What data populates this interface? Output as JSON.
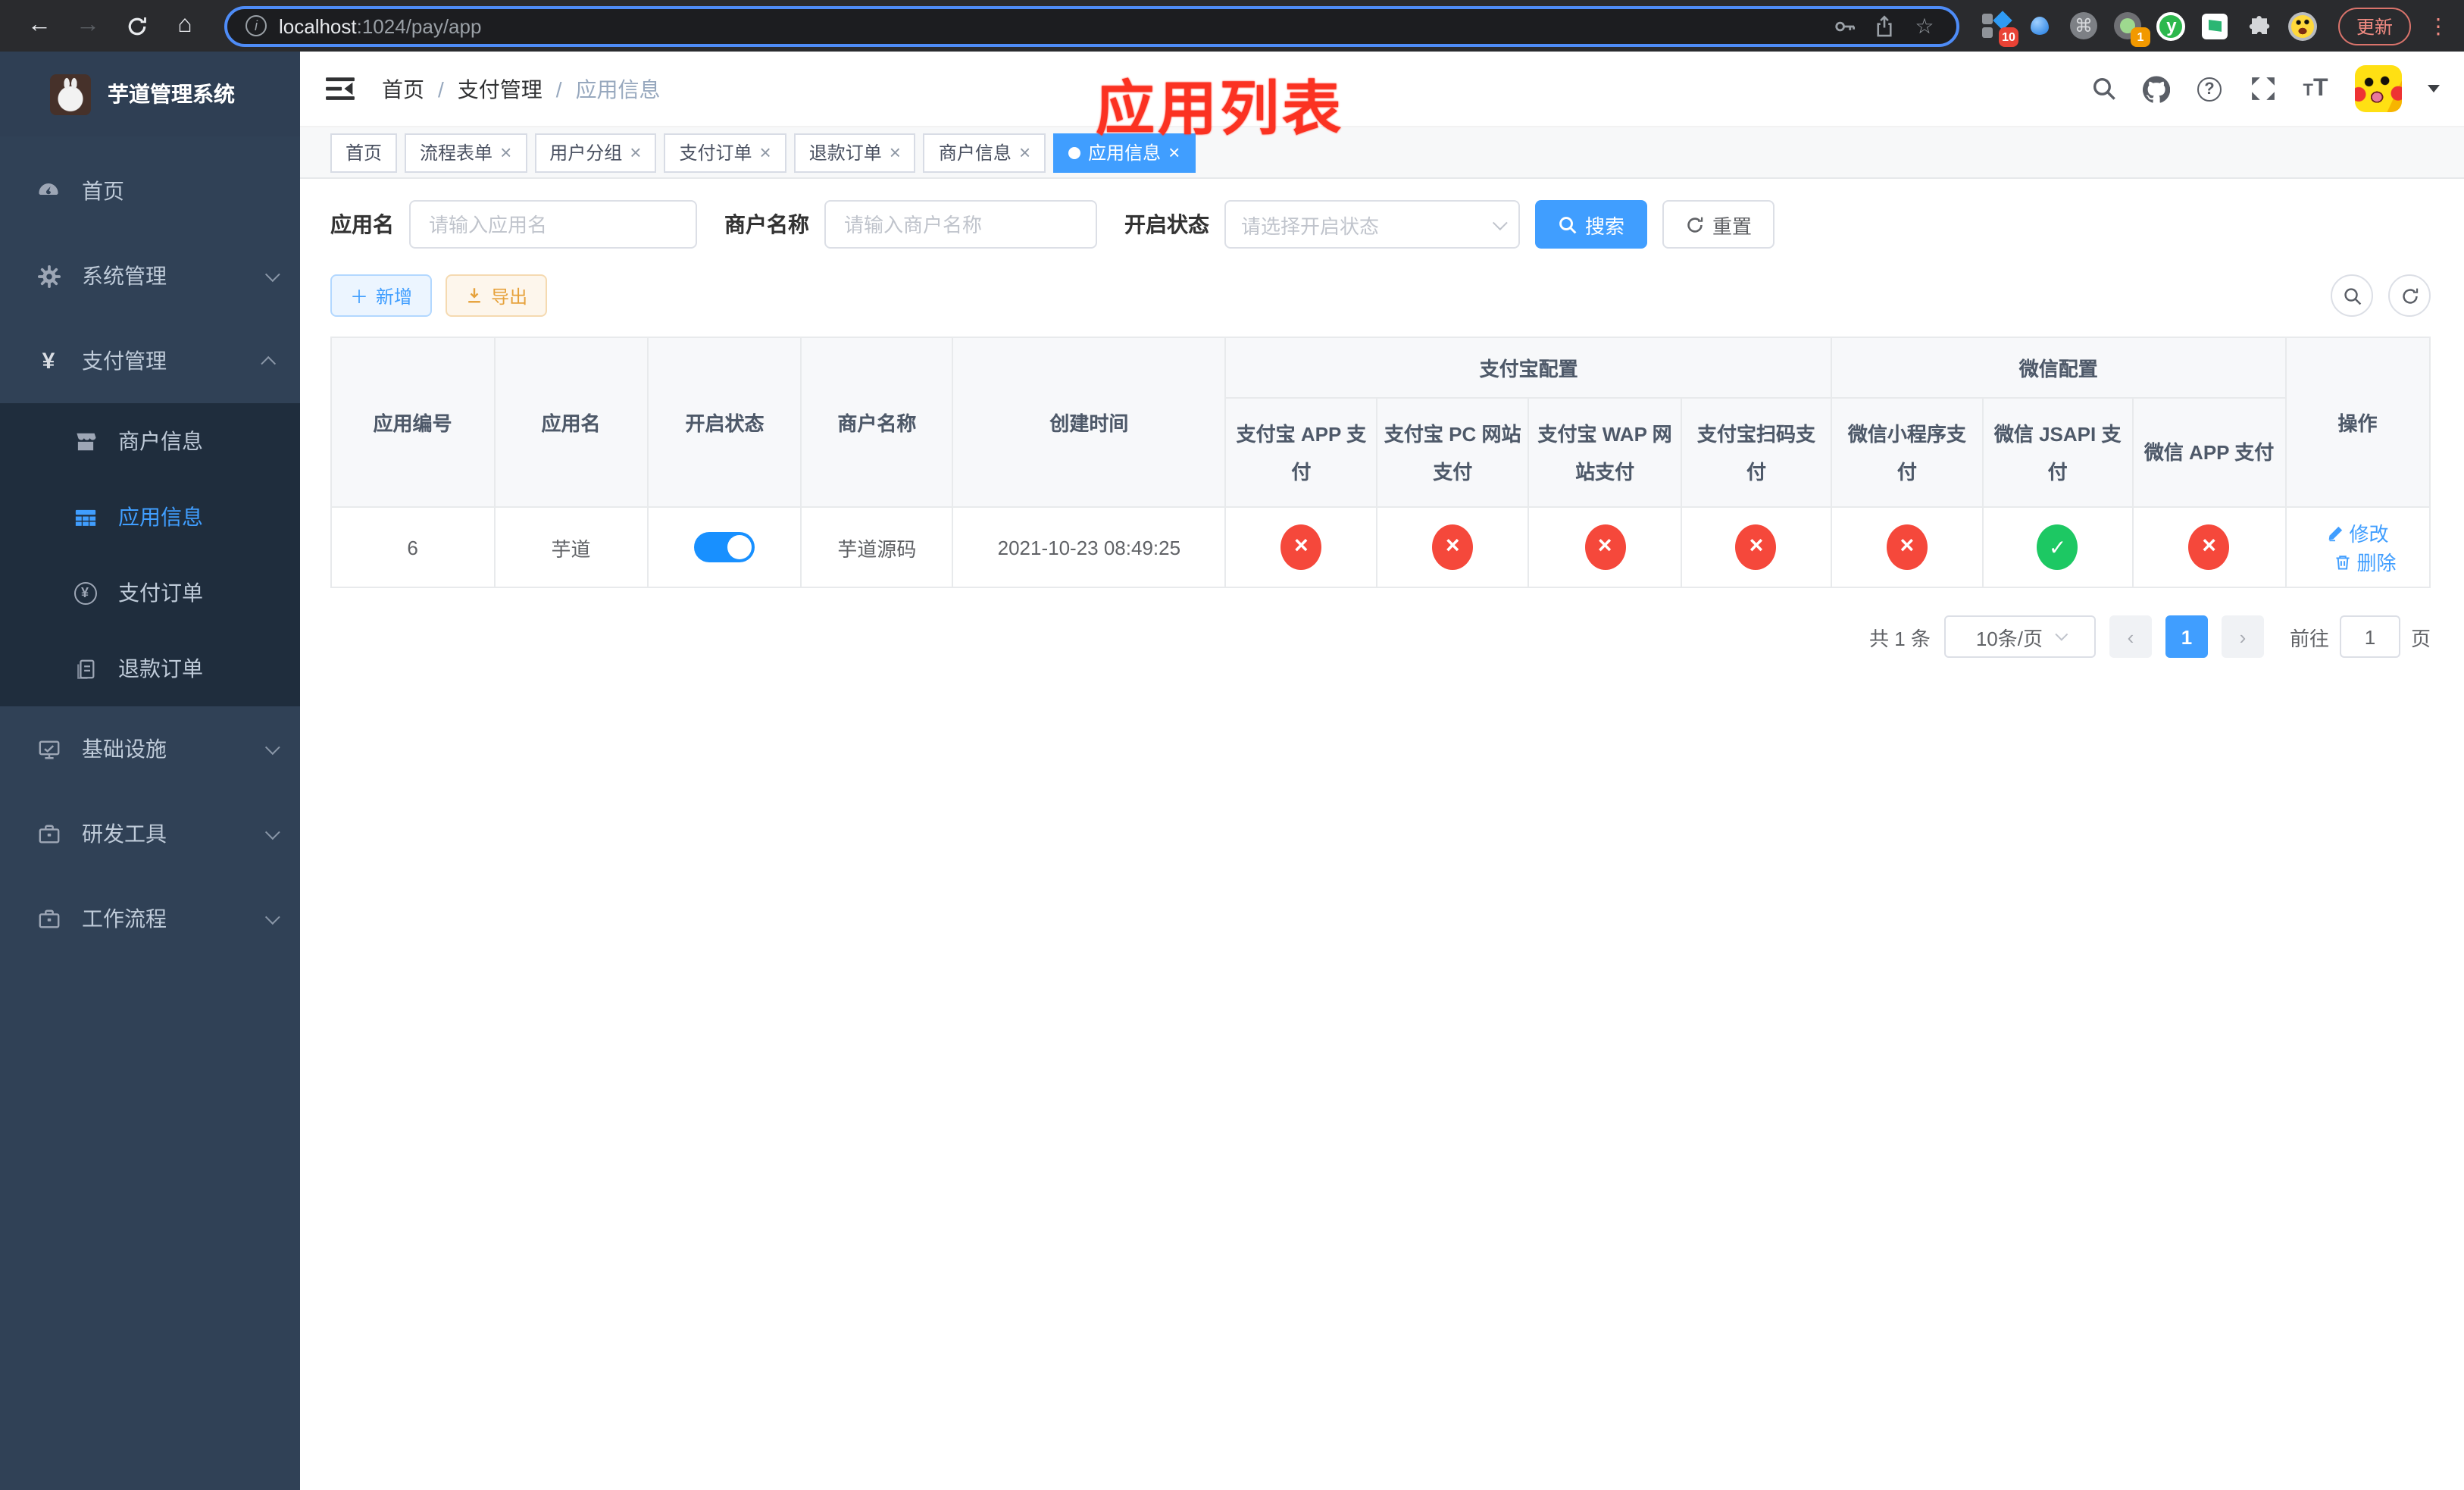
{
  "browser": {
    "host": "localhost",
    "path": ":1024/pay/app",
    "update_label": "更新",
    "ext_badge_a": "10",
    "ext_badge_b": "1",
    "ext_y_label": "y"
  },
  "annotation": {
    "text": "应用列表",
    "color": "#fb3222"
  },
  "sidebar": {
    "title": "芋道管理系统",
    "menu": [
      {
        "label": "首页"
      },
      {
        "label": "系统管理"
      },
      {
        "label": "支付管理"
      },
      {
        "label": "商户信息"
      },
      {
        "label": "应用信息"
      },
      {
        "label": "支付订单"
      },
      {
        "label": "退款订单"
      },
      {
        "label": "基础设施"
      },
      {
        "label": "研发工具"
      },
      {
        "label": "工作流程"
      }
    ]
  },
  "breadcrumb": {
    "items": [
      "首页",
      "支付管理",
      "应用信息"
    ],
    "separator": "/"
  },
  "tabs": [
    {
      "label": "首页",
      "active": false,
      "closable": false
    },
    {
      "label": "流程表单",
      "active": false,
      "closable": true
    },
    {
      "label": "用户分组",
      "active": false,
      "closable": true
    },
    {
      "label": "支付订单",
      "active": false,
      "closable": true
    },
    {
      "label": "退款订单",
      "active": false,
      "closable": true
    },
    {
      "label": "商户信息",
      "active": false,
      "closable": true
    },
    {
      "label": "应用信息",
      "active": true,
      "closable": true
    }
  ],
  "search": {
    "app_name_label": "应用名",
    "app_name_placeholder": "请输入应用名",
    "merchant_label": "商户名称",
    "merchant_placeholder": "请输入商户名称",
    "status_label": "开启状态",
    "status_placeholder": "请选择开启状态",
    "search_label": "搜索",
    "reset_label": "重置"
  },
  "toolbar": {
    "add_label": "新增",
    "export_label": "导出"
  },
  "table": {
    "groups": [
      "支付宝配置",
      "微信配置"
    ],
    "headers": [
      "应用编号",
      "应用名",
      "开启状态",
      "商户名称",
      "创建时间",
      "支付宝 APP 支付",
      "支付宝 PC 网站支付",
      "支付宝 WAP 网站支付",
      "支付宝扫码支付",
      "微信小程序支付",
      "微信 JSAPI 支付",
      "微信 APP 支付",
      "操作"
    ],
    "row": {
      "id": "6",
      "name": "芋道",
      "enabled": true,
      "merchant": "芋道源码",
      "created_at": "2021-10-23 08:49:25",
      "statuses": [
        "fail",
        "fail",
        "fail",
        "fail",
        "fail",
        "success",
        "fail"
      ],
      "edit_label": "修改",
      "delete_label": "删除"
    }
  },
  "pagination": {
    "total_text": "共 1 条",
    "page_size": "10条/页",
    "prev": "‹",
    "page": "1",
    "next": "›",
    "goto_label": "前往",
    "goto_value": "1",
    "unit_label": "页"
  },
  "colors": {
    "accent": "#409eff",
    "toggle_on": "#1890ff",
    "success": "#1dc863",
    "danger": "#f5483b",
    "warning": "#e6a23c",
    "annotation": "#fb3222",
    "sidebar_bg": "#304156",
    "submenu_bg": "#1f2d3d"
  }
}
